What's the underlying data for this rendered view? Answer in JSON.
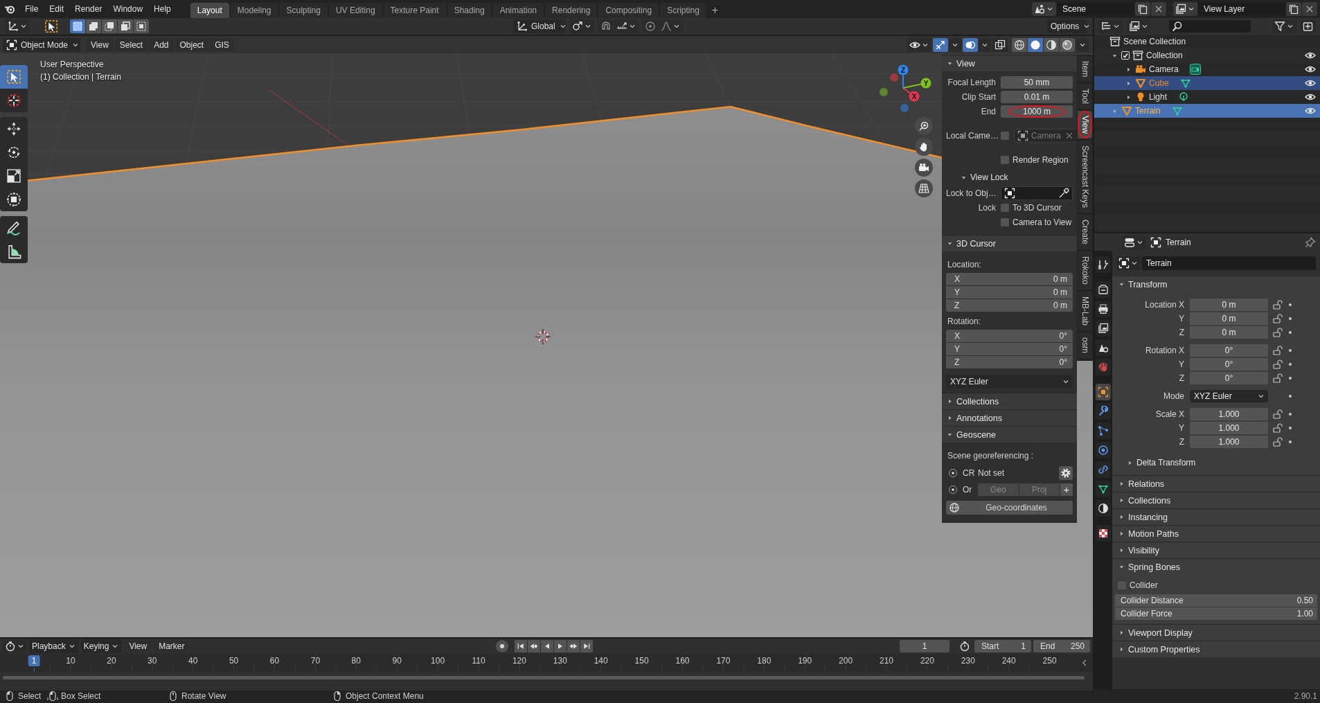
{
  "menu_bar": {
    "menus": [
      "File",
      "Edit",
      "Render",
      "Window",
      "Help"
    ],
    "workspaces": [
      {
        "label": "Layout",
        "selected": true
      },
      {
        "label": "Modeling",
        "selected": false
      },
      {
        "label": "Sculpting",
        "selected": false
      },
      {
        "label": "UV Editing",
        "selected": false
      },
      {
        "label": "Texture Paint",
        "selected": false
      },
      {
        "label": "Shading",
        "selected": false
      },
      {
        "label": "Animation",
        "selected": false
      },
      {
        "label": "Rendering",
        "selected": false
      },
      {
        "label": "Compositing",
        "selected": false
      },
      {
        "label": "Scripting",
        "selected": false
      }
    ],
    "add_workspace": "+",
    "scene": "Scene",
    "view_layer": "View Layer"
  },
  "tool_header": {
    "select_modes": [
      {
        "kind": "set",
        "selected": true
      },
      {
        "kind": "extend",
        "selected": false
      },
      {
        "kind": "subtract",
        "selected": false
      },
      {
        "kind": "invert",
        "selected": false
      },
      {
        "kind": "intersect",
        "selected": false
      }
    ],
    "orientation": "Global",
    "options": "Options"
  },
  "viewport_header": {
    "mode": "Object Mode",
    "menus": [
      "View",
      "Select",
      "Add",
      "Object",
      "GIS"
    ],
    "shading": [
      {
        "kind": "wireframe",
        "selected": false
      },
      {
        "kind": "solid",
        "selected": true
      },
      {
        "kind": "material",
        "selected": false
      },
      {
        "kind": "rendered",
        "selected": false
      }
    ]
  },
  "viewport": {
    "view_name": "User Perspective",
    "context": "(1) Collection | Terrain",
    "tools": [
      {
        "kind": "select",
        "selected": true
      },
      {
        "kind": "cursor",
        "selected": false
      },
      {
        "kind": "move",
        "selected": false
      },
      {
        "kind": "rotate",
        "selected": false
      },
      {
        "kind": "scale",
        "selected": false
      },
      {
        "kind": "transform",
        "selected": false
      },
      {
        "kind": "annotate",
        "selected": false
      },
      {
        "kind": "measure",
        "selected": false
      }
    ],
    "gizmo_axes": [
      {
        "label": "X",
        "color": "#e2384f"
      },
      {
        "label": "Y",
        "color": "#7ec21e"
      },
      {
        "label": "Z",
        "color": "#2f86f0"
      }
    ]
  },
  "sidebar": {
    "tabs": [
      {
        "label": "Item",
        "selected": false
      },
      {
        "label": "Tool",
        "selected": false
      },
      {
        "label": "View",
        "selected": true,
        "circled": true
      },
      {
        "label": "Screencast Keys",
        "selected": false
      },
      {
        "label": "Create",
        "selected": false
      },
      {
        "label": "Rokoko",
        "selected": false
      },
      {
        "label": "MB-Lab",
        "selected": false
      },
      {
        "label": "osm",
        "selected": false
      }
    ],
    "view": {
      "title": "View",
      "expanded": true,
      "fields": [
        {
          "label": "Focal Length",
          "value": "50 mm"
        },
        {
          "label": "Clip Start",
          "value": "0.01 m"
        },
        {
          "label": "End",
          "value": "1000 m",
          "circled": true
        }
      ],
      "local_camera": {
        "label": "Local Came…",
        "checked": false,
        "object": "Camera",
        "disabled": true
      },
      "render_region": {
        "label": "Render Region",
        "checked": false
      },
      "view_lock": {
        "title": "View Lock",
        "expanded": true,
        "lock_to_object": "Lock to Obj…",
        "lock_label": "Lock",
        "options": [
          {
            "label": "To 3D Cursor",
            "checked": false
          },
          {
            "label": "Camera to View",
            "checked": false
          }
        ]
      }
    },
    "cursor": {
      "title": "3D Cursor",
      "expanded": true,
      "location_label": "Location:",
      "location": [
        {
          "axis": "X",
          "value": "0 m"
        },
        {
          "axis": "Y",
          "value": "0 m"
        },
        {
          "axis": "Z",
          "value": "0 m"
        }
      ],
      "rotation_label": "Rotation:",
      "rotation": [
        {
          "axis": "X",
          "value": "0°"
        },
        {
          "axis": "Y",
          "value": "0°"
        },
        {
          "axis": "Z",
          "value": "0°"
        }
      ],
      "rotation_mode": "XYZ Euler"
    },
    "collapsed_panels": [
      {
        "title": "Collections",
        "expanded": false
      },
      {
        "title": "Annotations",
        "expanded": false
      }
    ],
    "geoscene": {
      "title": "Geoscene",
      "expanded": true,
      "heading": "Scene georeferencing :",
      "crs": {
        "label": "CR",
        "value": "Not set"
      },
      "origin": {
        "label": "Or",
        "buttons": [
          {
            "label": "Geo",
            "disabled": true
          },
          {
            "label": "Proj",
            "disabled": true
          }
        ],
        "add": "+"
      },
      "geo_coordinates": "Geo-coordinates"
    }
  },
  "outliner": {
    "root": {
      "label": "Scene Collection",
      "kind": "scene_collection",
      "children": [
        {
          "label": "Collection",
          "kind": "collection",
          "checked": true,
          "expanded": true,
          "selected": false,
          "active": false,
          "children": [
            {
              "label": "Camera",
              "kind": "camera",
              "expanded": false,
              "selected": false,
              "active": false
            },
            {
              "label": "Cube",
              "kind": "mesh",
              "expanded": false,
              "selected": true,
              "active": false
            },
            {
              "label": "Light",
              "kind": "light",
              "expanded": false,
              "selected": false,
              "active": false
            }
          ]
        },
        {
          "label": "Terrain",
          "kind": "mesh",
          "expanded": false,
          "selected": true,
          "active": true
        }
      ]
    }
  },
  "properties": {
    "tabs": [
      {
        "kind": "tool",
        "selected": false
      },
      {
        "kind": "render",
        "selected": false
      },
      {
        "kind": "output",
        "selected": false
      },
      {
        "kind": "view_layer",
        "selected": false
      },
      {
        "kind": "scene",
        "selected": false
      },
      {
        "kind": "world",
        "selected": false
      },
      {
        "kind": "object",
        "selected": true
      },
      {
        "kind": "modifiers",
        "selected": false
      },
      {
        "kind": "particles",
        "selected": false
      },
      {
        "kind": "physics",
        "selected": false
      },
      {
        "kind": "constraints",
        "selected": false
      },
      {
        "kind": "data",
        "selected": false
      },
      {
        "kind": "material",
        "selected": false
      },
      {
        "kind": "texture",
        "selected": false
      }
    ],
    "header": "Terrain",
    "name": "Terrain",
    "transform": {
      "title": "Transform",
      "expanded": true,
      "location": [
        {
          "label": "Location X",
          "value": "0 m"
        },
        {
          "label": "Y",
          "value": "0 m"
        },
        {
          "label": "Z",
          "value": "0 m"
        }
      ],
      "rotation": [
        {
          "label": "Rotation X",
          "value": "0°"
        },
        {
          "label": "Y",
          "value": "0°"
        },
        {
          "label": "Z",
          "value": "0°"
        }
      ],
      "mode": {
        "label": "Mode",
        "value": "XYZ Euler"
      },
      "scale": [
        {
          "label": "Scale X",
          "value": "1.000"
        },
        {
          "label": "Y",
          "value": "1.000"
        },
        {
          "label": "Z",
          "value": "1.000"
        }
      ],
      "delta": {
        "title": "Delta Transform",
        "expanded": false
      }
    },
    "panels": [
      {
        "title": "Relations",
        "expanded": false
      },
      {
        "title": "Collections",
        "expanded": false
      },
      {
        "title": "Instancing",
        "expanded": false
      },
      {
        "title": "Motion Paths",
        "expanded": false
      },
      {
        "title": "Visibility",
        "expanded": false
      },
      {
        "title": "Spring Bones",
        "expanded": true,
        "collider": {
          "label": "Collider",
          "checked": false
        },
        "fields": [
          {
            "label": "Collider Distance",
            "value": "0.50"
          },
          {
            "label": "Collider Force",
            "value": "1.00"
          }
        ]
      },
      {
        "title": "Viewport Display",
        "expanded": false
      },
      {
        "title": "Custom Properties",
        "expanded": false
      }
    ]
  },
  "timeline": {
    "menus": [
      "Playback",
      "Keying",
      "View",
      "Marker"
    ],
    "current_frame": "1",
    "start": {
      "label": "Start",
      "value": "1"
    },
    "end": {
      "label": "End",
      "value": "250"
    },
    "playhead": "1",
    "ruler": [
      "10",
      "20",
      "30",
      "40",
      "50",
      "60",
      "70",
      "80",
      "90",
      "100",
      "110",
      "120",
      "130",
      "140",
      "150",
      "160",
      "170",
      "180",
      "190",
      "200",
      "210",
      "220",
      "230",
      "240",
      "250"
    ]
  },
  "status_bar": {
    "items": [
      {
        "kind": "lmb",
        "label": "Select"
      },
      {
        "kind": "lmb_drag",
        "label": "Box Select"
      },
      {
        "kind": "mmb",
        "label": "Rotate View"
      },
      {
        "kind": "rmb",
        "label": "Object Context Menu"
      }
    ],
    "version": "2.90.1"
  }
}
